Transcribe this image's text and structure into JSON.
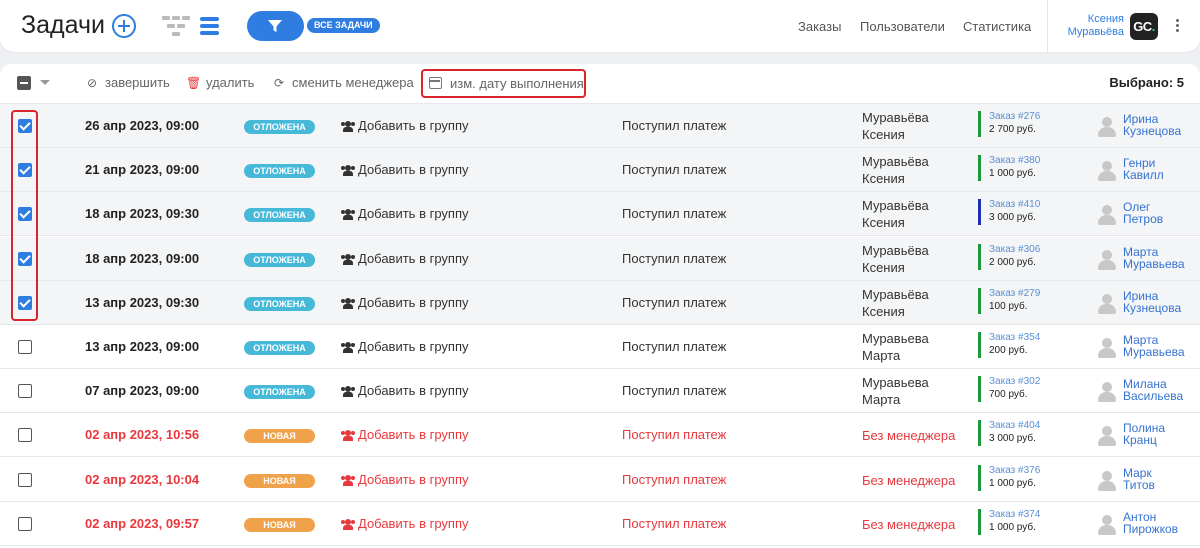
{
  "header": {
    "title": "Задачи",
    "filter_badge": "ВСЕ ЗАДАЧИ",
    "nav": [
      "Заказы",
      "Пользователи",
      "Статистика"
    ],
    "user_first": "Ксения",
    "user_last": "Муравьёва",
    "avatar_letters": "GC",
    "avatar_dot": "."
  },
  "toolbar": {
    "complete": "завершить",
    "delete": "удалить",
    "change_manager": "сменить менеджера",
    "change_date": "изм. дату выполнения",
    "selected": "Выбрано: 5"
  },
  "colors": {
    "accent": "#2f7de1",
    "status_postponed": "#46b9d8",
    "status_new": "#f0a24a",
    "highlight": "#d9262c",
    "overdue": "#e8383d"
  },
  "rows": [
    {
      "checked": true,
      "date": "26 апр 2023, 09:00",
      "status": "ОТЛОЖЕНА",
      "status_type": "postponed",
      "group": "Добавить в группу",
      "event": "Поступил платеж",
      "manager": [
        "Муравьёва",
        "Ксения"
      ],
      "order": "Заказ #276",
      "sum": "2 700 руб.",
      "order_color": "#1a9a3a",
      "client": [
        "Ирина",
        "Кузнецова"
      ],
      "overdue": false
    },
    {
      "checked": true,
      "date": "21 апр 2023, 09:00",
      "status": "ОТЛОЖЕНА",
      "status_type": "postponed",
      "group": "Добавить в группу",
      "event": "Поступил платеж",
      "manager": [
        "Муравьёва",
        "Ксения"
      ],
      "order": "Заказ #380",
      "sum": "1 000 руб.",
      "order_color": "#1a9a3a",
      "client": [
        "Генри",
        "Кавилл"
      ],
      "overdue": false
    },
    {
      "checked": true,
      "date": "18 апр 2023, 09:30",
      "status": "ОТЛОЖЕНА",
      "status_type": "postponed",
      "group": "Добавить в группу",
      "event": "Поступил платеж",
      "manager": [
        "Муравьёва",
        "Ксения"
      ],
      "order": "Заказ #410",
      "sum": "3 000 руб.",
      "order_color": "#1f2fb3",
      "client": [
        "Олег",
        "Петров"
      ],
      "overdue": false
    },
    {
      "checked": true,
      "date": "18 апр 2023, 09:00",
      "status": "ОТЛОЖЕНА",
      "status_type": "postponed",
      "group": "Добавить в группу",
      "event": "Поступил платеж",
      "manager": [
        "Муравьёва",
        "Ксения"
      ],
      "order": "Заказ #306",
      "sum": "2 000 руб.",
      "order_color": "#1a9a3a",
      "client": [
        "Марта",
        "Муравьева"
      ],
      "overdue": false
    },
    {
      "checked": true,
      "date": "13 апр 2023, 09:30",
      "status": "ОТЛОЖЕНА",
      "status_type": "postponed",
      "group": "Добавить в группу",
      "event": "Поступил платеж",
      "manager": [
        "Муравьёва",
        "Ксения"
      ],
      "order": "Заказ #279",
      "sum": "100 руб.",
      "order_color": "#1a9a3a",
      "client": [
        "Ирина",
        "Кузнецова"
      ],
      "overdue": false
    },
    {
      "checked": false,
      "date": "13 апр 2023, 09:00",
      "status": "ОТЛОЖЕНА",
      "status_type": "postponed",
      "group": "Добавить в группу",
      "event": "Поступил платеж",
      "manager": [
        "Муравьева",
        "Марта"
      ],
      "order": "Заказ #354",
      "sum": "200 руб.",
      "order_color": "#1a9a3a",
      "client": [
        "Марта",
        "Муравьева"
      ],
      "overdue": false
    },
    {
      "checked": false,
      "date": "07 апр 2023, 09:00",
      "status": "ОТЛОЖЕНА",
      "status_type": "postponed",
      "group": "Добавить в группу",
      "event": "Поступил платеж",
      "manager": [
        "Муравьева",
        "Марта"
      ],
      "order": "Заказ #302",
      "sum": "700 руб.",
      "order_color": "#1a9a3a",
      "client": [
        "Милана",
        "Васильева"
      ],
      "overdue": false
    },
    {
      "checked": false,
      "date": "02 апр 2023, 10:56",
      "status": "НОВАЯ",
      "status_type": "new",
      "group": "Добавить в группу",
      "event": "Поступил платеж",
      "manager": [
        "Без менеджера"
      ],
      "order": "Заказ #404",
      "sum": "3 000 руб.",
      "order_color": "#1a9a3a",
      "client": [
        "Полина",
        "Кранц"
      ],
      "overdue": true
    },
    {
      "checked": false,
      "date": "02 апр 2023, 10:04",
      "status": "НОВАЯ",
      "status_type": "new",
      "group": "Добавить в группу",
      "event": "Поступил платеж",
      "manager": [
        "Без менеджера"
      ],
      "order": "Заказ #376",
      "sum": "1 000 руб.",
      "order_color": "#1a9a3a",
      "client": [
        "Марк",
        "Титов"
      ],
      "overdue": true
    },
    {
      "checked": false,
      "date": "02 апр 2023, 09:57",
      "status": "НОВАЯ",
      "status_type": "new",
      "group": "Добавить в группу",
      "event": "Поступил платеж",
      "manager": [
        "Без менеджера"
      ],
      "order": "Заказ #374",
      "sum": "1 000 руб.",
      "order_color": "#1a9a3a",
      "client": [
        "Антон",
        "Пирожков"
      ],
      "overdue": true
    }
  ]
}
